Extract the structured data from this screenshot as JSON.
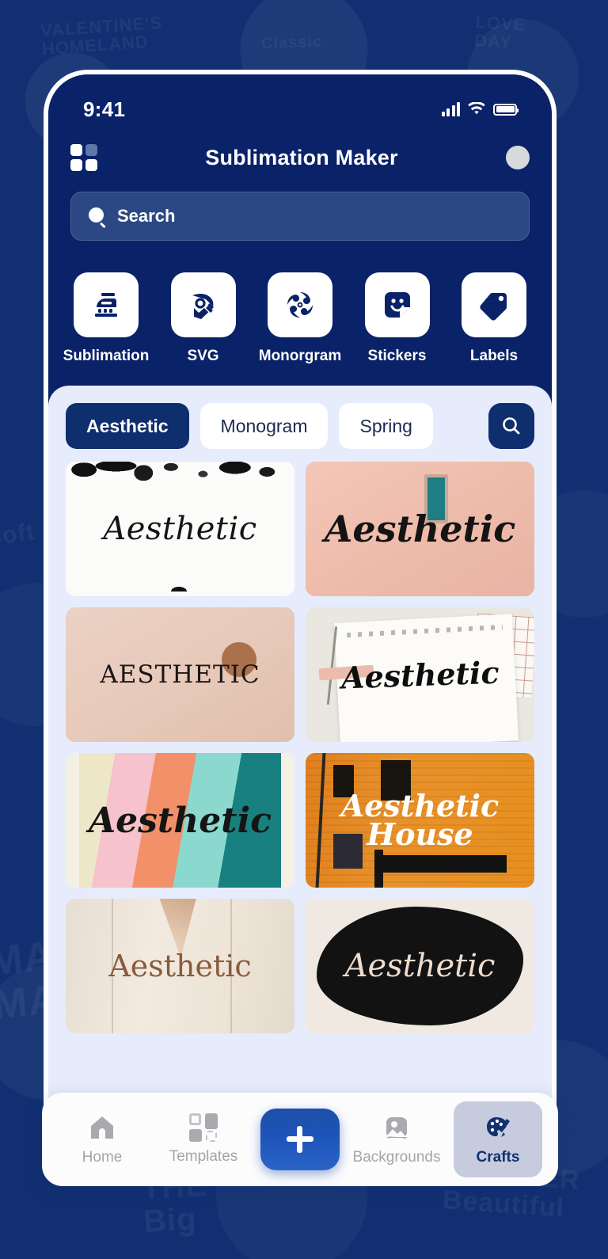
{
  "background": {
    "color": "#123071",
    "ghost_texts": [
      "VALENTINE'S\nHOMELAND",
      "LOVE\nDAY",
      "Classic",
      "MADE\nMADE",
      "THE\nBig",
      "FOREVER\nBeautiful",
      "Soft"
    ]
  },
  "status_bar": {
    "time": "9:41",
    "signal_icon": "cellular-signal-icon",
    "wifi_icon": "wifi-icon",
    "battery_icon": "battery-icon"
  },
  "header": {
    "menu_icon": "grid-menu-icon",
    "title": "Sublimation Maker",
    "avatar": "profile-avatar",
    "accent_color": "#0A2268"
  },
  "search": {
    "placeholder": "Search",
    "icon": "search-icon"
  },
  "categories": [
    {
      "label": "Sublimation",
      "icon": "iron-icon"
    },
    {
      "label": "SVG",
      "icon": "pen-nib-icon"
    },
    {
      "label": "Monorgram",
      "icon": "spiral-icon"
    },
    {
      "label": "Stickers",
      "icon": "sticker-smiley-icon"
    },
    {
      "label": "Labels",
      "icon": "tag-icon"
    }
  ],
  "filter_chips": {
    "items": [
      {
        "label": "Aesthetic",
        "active": true
      },
      {
        "label": "Monogram",
        "active": false
      },
      {
        "label": "Spring",
        "active": false
      }
    ],
    "search_button_icon": "search-icon"
  },
  "templates": [
    {
      "label": "Aesthetic",
      "style": "thin-script-ink-splatter"
    },
    {
      "label": "Aesthetic",
      "style": "bold-script-peach"
    },
    {
      "label": "AESTHETIC",
      "style": "serif-caps-blush"
    },
    {
      "label": "Aesthetic",
      "style": "paper-collage-script"
    },
    {
      "label": "Aesthetic",
      "style": "colorful-waves-brush"
    },
    {
      "label": "Aesthetic\nHouse",
      "style": "orange-building-photo"
    },
    {
      "label": "Aesthetic",
      "style": "cream-paper-brown-serif"
    },
    {
      "label": "Aesthetic",
      "style": "black-blob-light-script"
    }
  ],
  "bottom_nav": {
    "items": [
      {
        "label": "Home",
        "icon": "home-icon",
        "active": false
      },
      {
        "label": "Templates",
        "icon": "templates-icon",
        "active": false
      },
      {
        "label": "Backgrounds",
        "icon": "image-icon",
        "active": false
      },
      {
        "label": "Crafts",
        "icon": "palette-icon",
        "active": true
      }
    ],
    "fab": {
      "icon": "plus-icon",
      "color": "#1D54B8"
    },
    "active_color": "#12306E",
    "inactive_color": "#A4A5AA"
  }
}
